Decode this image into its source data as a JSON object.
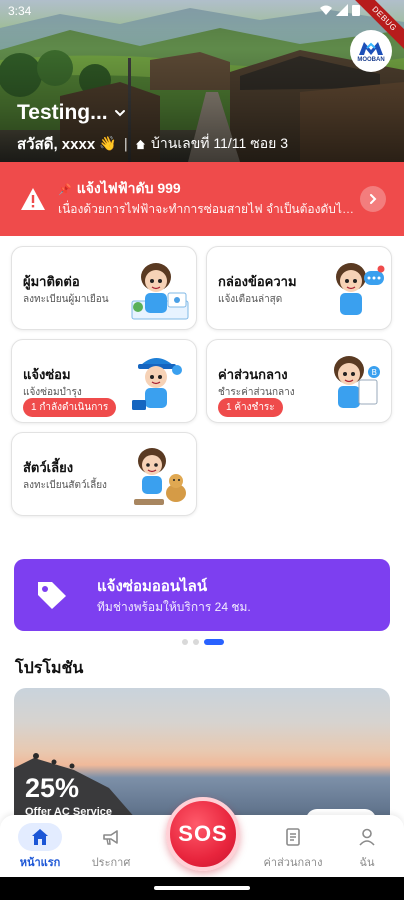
{
  "status_bar": {
    "time": "3:34",
    "debug_banner": "DEBUG"
  },
  "header": {
    "logo_text": "MOOBAN",
    "project_name": "Testing...",
    "greeting": "สวัสดี, xxxx",
    "wave_emoji": "👋",
    "address": "บ้านเลขที่ 11/11 ซอย 3"
  },
  "alert": {
    "title": "แจ้งไฟฟ้าดับ 999",
    "body": "เนื่องด้วยการไฟฟ้าจะทำการซ่อมสายไฟ จำเป็นต้องดับไฟ...",
    "color": "#ef4b4b"
  },
  "menu": [
    {
      "title": "ผู้มาติดต่อ",
      "subtitle": "ลงทะเบียนผู้มาเยือน",
      "badge": ""
    },
    {
      "title": "กล่องข้อความ",
      "subtitle": "แจ้งเตือนล่าสุด",
      "badge": ""
    },
    {
      "title": "แจ้งซ่อม",
      "subtitle": "แจ้งซ่อมบำรุง",
      "badge": "1 กำลังดำเนินการ"
    },
    {
      "title": "ค่าส่วนกลาง",
      "subtitle": "ชำระค่าส่วนกลาง",
      "badge": "1 ค้างชำระ"
    },
    {
      "title": "สัตว์เลี้ยง",
      "subtitle": "ลงทะเบียนสัตว์เลี้ยง",
      "badge": ""
    }
  ],
  "banner": {
    "title": "แจ้งซ่อมออนไลน์",
    "subtitle": "ทีมช่างพร้อมให้บริการ 24 ชม.",
    "color": "#7d3ff0",
    "active_slide": 3,
    "slide_count": 3
  },
  "promotions": {
    "title": "โปรโมชัน",
    "card": {
      "percent": "25%",
      "offer": "Offer AC Service"
    }
  },
  "bottom_nav": {
    "items": [
      {
        "label": "หน้าแรก",
        "icon": "home-icon",
        "active": true
      },
      {
        "label": "ประกาศ",
        "icon": "megaphone-icon",
        "active": false
      },
      {
        "label": "ค่าส่วนกลาง",
        "icon": "receipt-icon",
        "active": false
      },
      {
        "label": "ฉัน",
        "icon": "person-icon",
        "active": false
      }
    ],
    "sos_label": "SOS"
  }
}
